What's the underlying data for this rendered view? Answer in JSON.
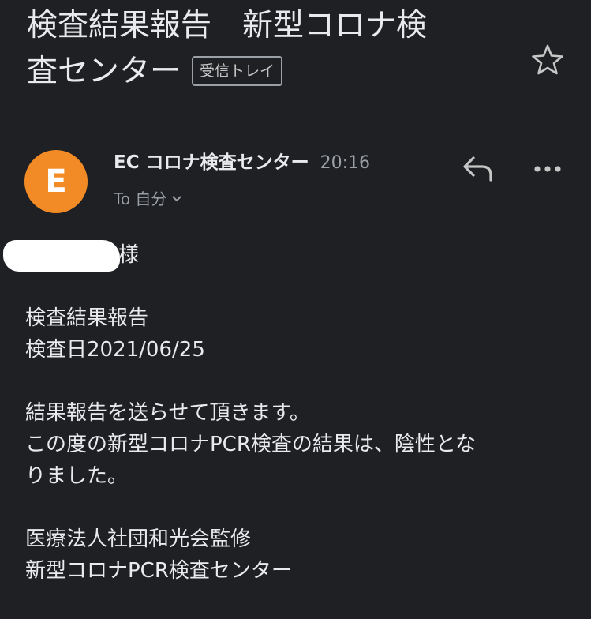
{
  "header": {
    "subject_line1": "検査結果報告　新型コロナ検",
    "subject_line2": "査センター",
    "label": "受信トレイ",
    "star_icon": "star-outline-icon"
  },
  "message": {
    "avatar_letter": "E",
    "avatar_color": "#f28b25",
    "sender": "EC コロナ検査センター",
    "time": "20:16",
    "to": "To 自分",
    "reply_icon": "reply-icon",
    "more_icon": "more-horizontal-icon"
  },
  "body": {
    "salutation": "様",
    "report_title": "検査結果報告",
    "test_date": "検査日2021/06/25",
    "line1": "結果報告を送らせて頂きます。",
    "line2a": "この度の新型コロナPCR検査の結果は、陰性とな",
    "line2b": "りました。",
    "sig1": "医療法人社団和光会監修",
    "sig2": "新型コロナPCR検査センター"
  }
}
